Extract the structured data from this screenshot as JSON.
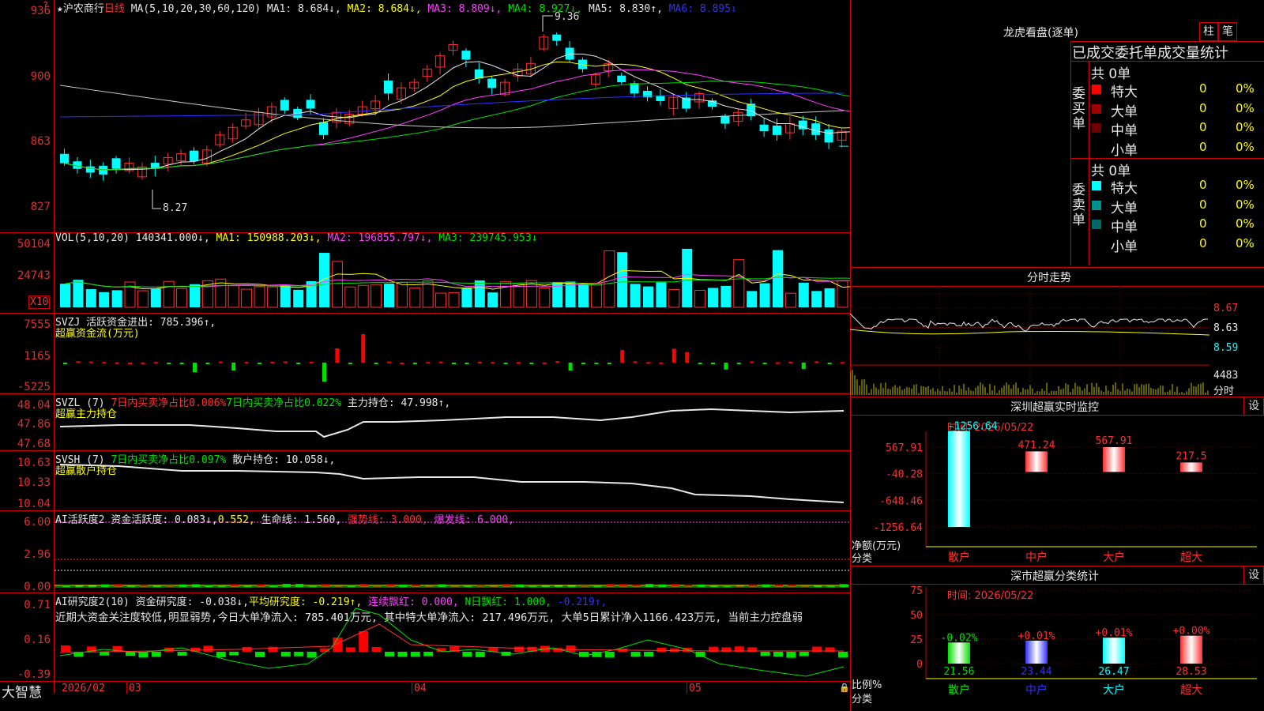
{
  "main": {
    "star": "★",
    "stock_name": "沪农商行",
    "period": "日线",
    "ma_label": "MA(5,10,20,30,60,120)",
    "ma": [
      {
        "name": "MA1:",
        "value": "8.684↓",
        "color": "#e8e8e8"
      },
      {
        "name": "MA2:",
        "value": "8.684↓",
        "color": "#ffff00"
      },
      {
        "name": "MA3:",
        "value": "8.809↓",
        "color": "#ff40ff"
      },
      {
        "name": "MA4:",
        "value": "8.927↓",
        "color": "#00e000"
      },
      {
        "name": "MA5:",
        "value": "8.830↑",
        "color": "#e8e8e8"
      },
      {
        "name": "MA6:",
        "value": "8.895↓",
        "color": "#3030ff"
      }
    ],
    "y_ticks": [
      "936",
      "900",
      "863",
      "827"
    ],
    "high_label": "9.36",
    "low_label": "8.27"
  },
  "vol": {
    "label": "VOL(5,10,20)",
    "value": "140341.000↓,",
    "ma1": "MA1: 150988.203↓,",
    "ma2": "MA2: 196855.797↓,",
    "ma3": "MA3: 239745.953↓",
    "y_ticks": [
      "50104",
      "24743"
    ],
    "unit": "X10"
  },
  "svzj": {
    "label": "SVZJ",
    "text": "活跃资金进出: 785.396↑,",
    "sub": "超赢资金流(万元)",
    "y_ticks": [
      "7555",
      "1165",
      "-5225"
    ]
  },
  "svzl": {
    "label": "SVZL (7)",
    "t1": "7日内买卖净占比0.006%",
    "t2": "7日内买卖净占比0.022%",
    "t3": "主力持仓: 47.998↑,",
    "sub": "超赢主力持仓",
    "y_ticks": [
      "48.04",
      "47.86",
      "47.68"
    ]
  },
  "svsh": {
    "label": "SVSH (7)",
    "t1": "7日内买卖净占比0.097%",
    "t2": "散户持仓: 10.058↓,",
    "sub": "超赢散户持仓",
    "y_ticks": [
      "10.63",
      "10.33",
      "10.04"
    ]
  },
  "ai": {
    "label": "AI活跃度2",
    "t1": "资金活跃度: 0.083↓,",
    "t2": "0.552,",
    "t3": "生命线: 1.560,",
    "t4": "强势线: 3.000,",
    "t5": "爆发线: 6.000,",
    "y_ticks": [
      "6.00",
      "2.96",
      "0.00"
    ]
  },
  "air": {
    "label": "AI研究度2(10)",
    "t1": "资金研究度: -0.038↓,",
    "t2": "平均研究度: -0.219↑,",
    "t3": "连续飘红: 0.000,",
    "t4": "N日飘红: 1.000,",
    "t5": "-0.219↑,",
    "comment": "近期大资金关注度较低,明显弱势,今日大单净流入: 785.401万元, 其中特大单净流入: 217.496万元, 大单5日累计净入1166.423万元, 当前主力控盘弱",
    "y_ticks": [
      "0.71",
      "0.16",
      "-0.39"
    ]
  },
  "bottom": {
    "brand": "大智慧",
    "dates": [
      "2026/02",
      "03",
      "04",
      "05"
    ]
  },
  "lhb": {
    "title": "龙虎看盘(逐单)",
    "tabs": [
      "柱",
      "笔"
    ],
    "header": "已成交委托单成交量统计",
    "buy_label": "委买单",
    "sell_label": "委卖单",
    "buy_total": "共 0单",
    "sell_total": "共 0单",
    "buy_rows": [
      {
        "name": "特大",
        "n": "0",
        "p": "0%",
        "color": "#ff0000"
      },
      {
        "name": "大单",
        "n": "0",
        "p": "0%",
        "color": "#a00000"
      },
      {
        "name": "中单",
        "n": "0",
        "p": "0%",
        "color": "#700000"
      },
      {
        "name": "小单",
        "n": "0",
        "p": "0%",
        "color": ""
      }
    ],
    "sell_rows": [
      {
        "name": "特大",
        "n": "0",
        "p": "0%",
        "color": "#00ffff"
      },
      {
        "name": "大单",
        "n": "0",
        "p": "0%",
        "color": "#009090"
      },
      {
        "name": "中单",
        "n": "0",
        "p": "0%",
        "color": "#006868"
      },
      {
        "name": "小单",
        "n": "0",
        "p": "0%",
        "color": ""
      }
    ]
  },
  "fenshi": {
    "title": "分时走势",
    "y_ticks": [
      "8.67",
      "8.63",
      "8.59"
    ],
    "vol_tick": "4483",
    "vol_label": "分时"
  },
  "monitor": {
    "title": "深圳超赢实时监控",
    "setting": "设",
    "time": "时间: 2026/05/22",
    "y_ticks": [
      "567.91",
      "-40.28",
      "-648.46",
      "-1256.64"
    ],
    "ylabel1": "净额(万元)",
    "ylabel2": "分类",
    "bars": [
      {
        "cat": "散户",
        "value": -1256.64,
        "label": "-1256.64",
        "color": "#00ffff"
      },
      {
        "cat": "中户",
        "value": 471.24,
        "label": "471.24",
        "color": "#ff3030"
      },
      {
        "cat": "大户",
        "value": 567.91,
        "label": "567.91",
        "color": "#ff3030"
      },
      {
        "cat": "超大",
        "value": 217.5,
        "label": "217.5",
        "color": "#ff3030"
      }
    ]
  },
  "classify": {
    "title": "深市超赢分类统计",
    "setting": "设",
    "time": "时间: 2026/05/22",
    "y_ticks": [
      "75",
      "50",
      "25",
      "0"
    ],
    "ylabel1": "比例%",
    "ylabel2": "分类",
    "bars": [
      {
        "cat": "散户",
        "value": 21.56,
        "label": "21.56",
        "delta": "-0.02%",
        "color": "#00e000",
        "cat_color": "#00e000"
      },
      {
        "cat": "中户",
        "value": 23.44,
        "label": "23.44",
        "delta": "+0.01%",
        "color": "#3030ff",
        "cat_color": "#3030ff"
      },
      {
        "cat": "大户",
        "value": 26.47,
        "label": "26.47",
        "delta": "+0.01%",
        "color": "#00ffff",
        "cat_color": "#00ffff"
      },
      {
        "cat": "超大",
        "value": 28.53,
        "label": "28.53",
        "delta": "+0.00%",
        "color": "#ff3030",
        "cat_color": "#ff3030"
      }
    ]
  },
  "chart_data": {
    "type": "bar",
    "title": "",
    "candles_close": [
      8.55,
      8.52,
      8.5,
      8.49,
      8.52,
      8.55,
      8.53,
      8.52,
      8.58,
      8.6,
      8.56,
      8.62,
      8.7,
      8.74,
      8.78,
      8.82,
      8.85,
      8.83,
      8.79,
      8.84,
      8.7,
      8.82,
      8.81,
      8.85,
      8.88,
      8.92,
      8.95,
      8.98,
      9.05,
      9.12,
      9.18,
      9.1,
      9.0,
      8.95,
      8.98,
      9.05,
      9.08,
      9.22,
      9.2,
      9.1,
      9.05,
      9.02,
      9.08,
      8.98,
      8.92,
      8.9,
      8.88,
      8.9,
      8.84,
      8.92,
      8.85,
      8.76,
      8.82,
      8.8,
      8.72,
      8.7,
      8.76,
      8.73,
      8.7,
      8.66,
      8.72,
      8.78,
      8.7,
      8.67,
      8.7,
      8.66,
      8.64
    ],
    "colors_red": [
      0,
      0,
      0,
      0,
      0,
      1,
      1,
      0,
      1,
      1,
      0,
      1,
      1,
      1,
      1,
      1,
      1,
      0,
      0,
      0,
      0,
      1,
      1,
      1,
      1,
      0,
      1,
      1,
      1,
      1,
      1,
      0,
      0,
      0,
      1,
      1,
      1,
      1,
      0,
      0,
      0,
      1,
      1,
      0,
      0,
      0,
      0,
      1,
      0,
      1,
      0,
      0,
      1,
      0,
      0,
      0,
      1,
      0,
      0,
      0,
      1,
      1,
      0,
      0,
      1,
      0,
      0
    ]
  }
}
